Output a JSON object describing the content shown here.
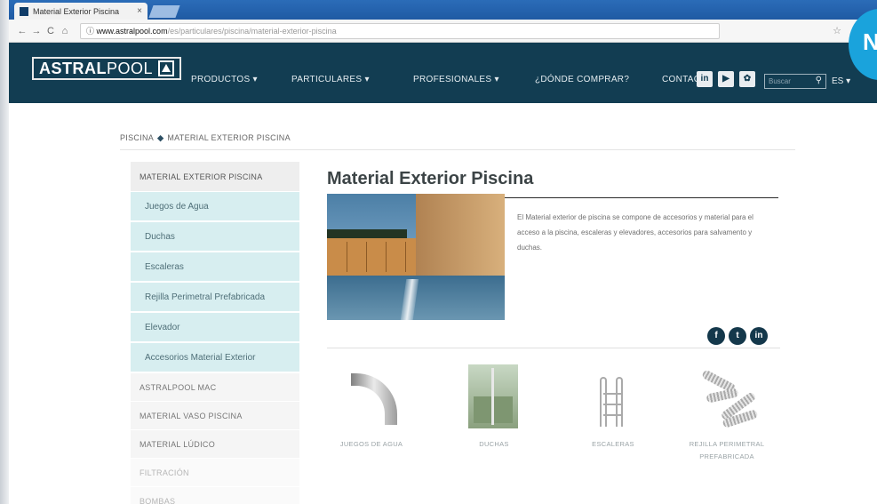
{
  "browser": {
    "tab_title": "Material Exterior Piscina",
    "tab_close": "×",
    "nav": {
      "back": "←",
      "forward": "→",
      "reload": "C",
      "home": "⌂",
      "info": "ⓘ"
    },
    "url_host": "www.astralpool.com",
    "url_path": "/es/particulares/piscina/material-exterior-piscina",
    "star": "☆"
  },
  "header": {
    "logo_bold": "ASTRAL",
    "logo_light": "POOL",
    "menu": [
      "PRODUCTOS ▾",
      "PARTICULARES ▾",
      "PROFESIONALES ▾",
      "¿DÓNDE COMPRAR?",
      "CONTACTO"
    ],
    "social": [
      "in",
      "▶",
      "✿"
    ],
    "search_placeholder": "Buscar",
    "search_icon": "⚲",
    "language": "ES ▾",
    "badge_letter": "N"
  },
  "breadcrumb": {
    "root": "PISCINA",
    "separator": "◆",
    "current": "MATERIAL EXTERIOR PISCINA"
  },
  "sidebar": {
    "section_title": "MATERIAL EXTERIOR PISCINA",
    "subitems": [
      "Juegos de Agua",
      "Duchas",
      "Escaleras",
      "Rejilla Perimetral Prefabricada",
      "Elevador",
      "Accesorios Material Exterior"
    ],
    "sections": [
      "ASTRALPOOL MAC",
      "MATERIAL VASO PISCINA",
      "MATERIAL LÚDICO",
      "FILTRACIÓN",
      "BOMBAS"
    ]
  },
  "main": {
    "title": "Material Exterior Piscina",
    "description": "El Material exterior de piscina se compone de accesorios y material para el acceso a la piscina, escaleras y elevadores, accesorios para salvamento y duchas.",
    "share_icons": [
      "f",
      "t",
      "in"
    ],
    "products": [
      "JUEGOS DE AGUA",
      "DUCHAS",
      "ESCALERAS",
      "REJILLA PERIMETRAL PREFABRICADA"
    ]
  }
}
